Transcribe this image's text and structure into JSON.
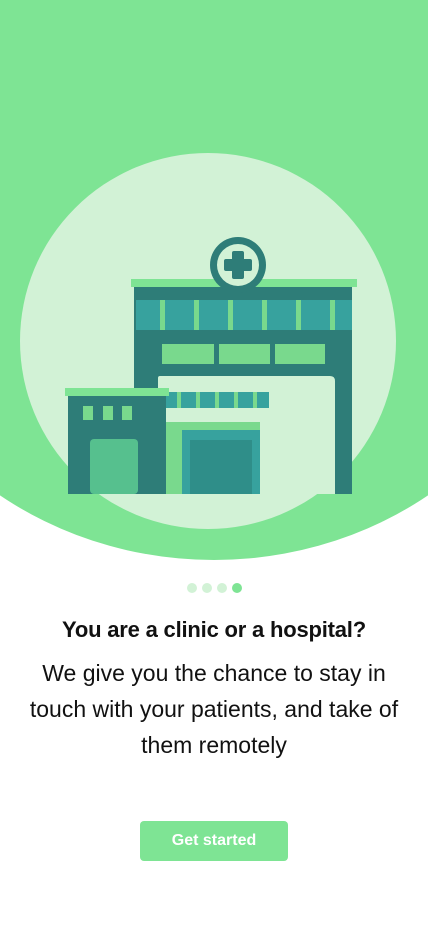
{
  "onboarding": {
    "title": "You are a clinic or a hospital?",
    "description": "We give you the chance to stay in touch with your patients, and take of them remotely",
    "cta_label": "Get started",
    "pager": {
      "total": 4,
      "active_index": 3
    }
  },
  "colors": {
    "accent": "#7ee494",
    "hero_circle": "#d2f2d6",
    "building_dark": "#2e7d78",
    "building_teal": "#37a29e",
    "window_green": "#79d98d"
  },
  "illustration": {
    "icon": "hospital-building-illustration",
    "badge_icon": "medical-cross-icon"
  }
}
